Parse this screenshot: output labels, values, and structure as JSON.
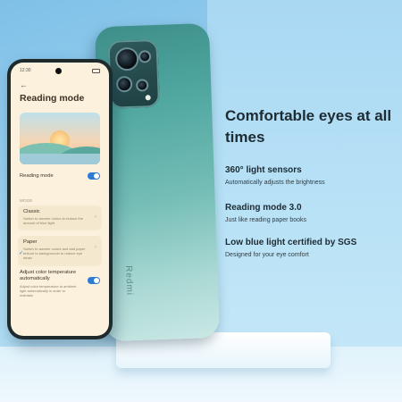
{
  "marketing": {
    "headline": "Comfortable eyes at all times",
    "features": [
      {
        "title": "360° light sensors",
        "desc": "Automatically adjusts the brightness"
      },
      {
        "title": "Reading mode 3.0",
        "desc": "Just like reading paper books"
      },
      {
        "title": "Low blue light certified by SGS",
        "desc": "Designed for your eye comfort"
      }
    ]
  },
  "phone_back": {
    "brand": "Redmi",
    "color": "#4fa7a0"
  },
  "screen": {
    "status_time": "12:30",
    "back": "←",
    "title": "Reading mode",
    "toggle_label": "Reading mode",
    "reading_mode_on": true,
    "section_label": "MODE",
    "modes": [
      {
        "name": "Classic",
        "desc": "Switch to warmer colors to reduce the amount of blue light",
        "selected": false
      },
      {
        "name": "Paper",
        "desc": "Switch to warmer colors and add paper texture to backgrounds to reduce eye strain",
        "selected": true
      }
    ],
    "auto_title": "Adjust color temperature automatically",
    "auto_desc": "Adjust color temperature to ambient light automatically in order to maintain",
    "auto_on": true,
    "accent": "#2e7bd6",
    "background": "#fbf1dc"
  }
}
